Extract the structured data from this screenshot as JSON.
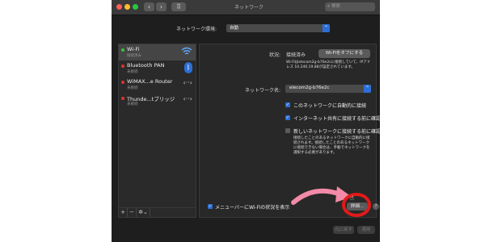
{
  "window": {
    "title": "ネットワーク",
    "search_placeholder": "検索",
    "back": "‹",
    "forward": "›",
    "grid": "⠿"
  },
  "location": {
    "label": "ネットワーク環境:",
    "value": "自動"
  },
  "services": [
    {
      "name": "Wi-Fi",
      "status": "接続済み",
      "dot": "#3cc13b",
      "icon": "wifi-icon"
    },
    {
      "name": "Bluetooth PAN",
      "status": "未接続",
      "dot": "#e0352b",
      "icon": "bluetooth-icon"
    },
    {
      "name": "WiMAX...e Router",
      "status": "未接続",
      "dot": "#e0352b",
      "icon": "ethernet-arrows-icon"
    },
    {
      "name": "Thunde...tブリッジ",
      "status": "未接続",
      "dot": "#e0352b",
      "icon": "ethernet-arrows-icon"
    }
  ],
  "sidebar_tools": {
    "add": "+",
    "remove": "−",
    "gear": "✲⌄"
  },
  "status": {
    "label": "状況:",
    "value": "接続済み",
    "turn_off_button": "Wi-Fiをオフにする",
    "description": "Wi-Fiはelecom2g-b76e2cに接続していて、IPアドレス 10.240.19.88が設定されています。"
  },
  "network_name": {
    "label": "ネットワーク名:",
    "value": "elecom2g-b76e2c"
  },
  "options": [
    {
      "label": "このネットワークに自動的に接続",
      "checked": true
    },
    {
      "label": "インターネット共有に接続する前に確認",
      "checked": true
    },
    {
      "label": "新しいネットワークに接続する前に確認",
      "checked": false
    }
  ],
  "new_network_note": "接続したことのあるネットワークに自動的に接続されます。接続したことのあるネットワークに接続できない場合は、手動でネットワークを選択する必要があります。",
  "menubar_option": {
    "label": "メニューバーにWi-Fiの状況を表示",
    "checked": true
  },
  "advanced_button": "詳細...",
  "help": "?",
  "revert_button": "元に戻す",
  "apply_button": "適用",
  "colors": {
    "accent": "#2d6fd6",
    "highlight_circle": "#e11a1a",
    "arrow": "#f28aa8"
  }
}
